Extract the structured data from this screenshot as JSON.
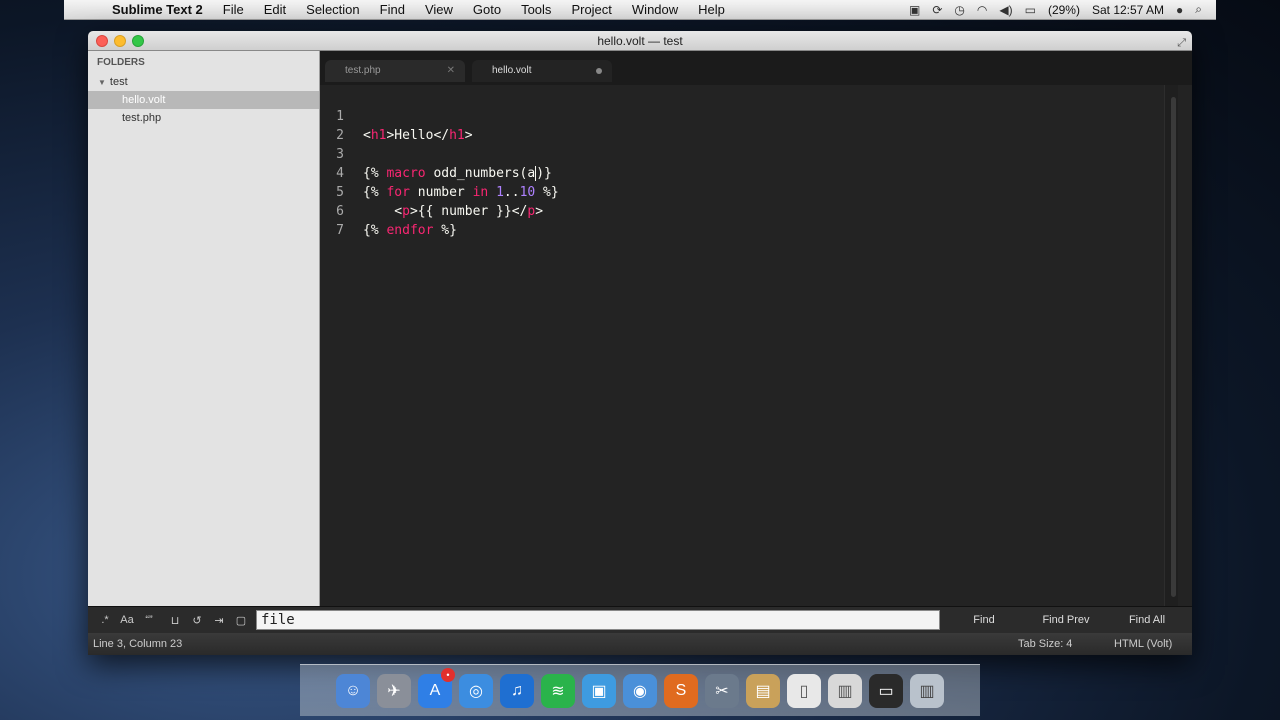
{
  "menubar": {
    "app_name": "Sublime Text 2",
    "items": [
      "File",
      "Edit",
      "Selection",
      "Find",
      "View",
      "Goto",
      "Tools",
      "Project",
      "Window",
      "Help"
    ],
    "battery": "(29%)",
    "clock": "Sat 12:57 AM"
  },
  "window": {
    "title": "hello.volt — test"
  },
  "sidebar": {
    "header": "FOLDERS",
    "folder": "test",
    "files": [
      "hello.volt",
      "test.php"
    ]
  },
  "tabs": [
    {
      "label": "test.php",
      "active": false
    },
    {
      "label": "hello.volt",
      "active": true
    }
  ],
  "editor": {
    "line_numbers": [
      "1",
      "2",
      "3",
      "4",
      "5",
      "6",
      "7"
    ]
  },
  "find": {
    "value": "file",
    "buttons": {
      "find": "Find",
      "find_prev": "Find Prev",
      "find_all": "Find All"
    },
    "options": [
      "regex",
      "case",
      "whole-word",
      "wrap",
      "in-selection",
      "highlight"
    ]
  },
  "status": {
    "position": "Line 3, Column 23",
    "tab_size": "Tab Size: 4",
    "syntax": "HTML (Volt)"
  },
  "colors": {
    "keyword": "#f92672",
    "number": "#ae81ff",
    "text": "#f8f8f2",
    "background": "#232323"
  }
}
